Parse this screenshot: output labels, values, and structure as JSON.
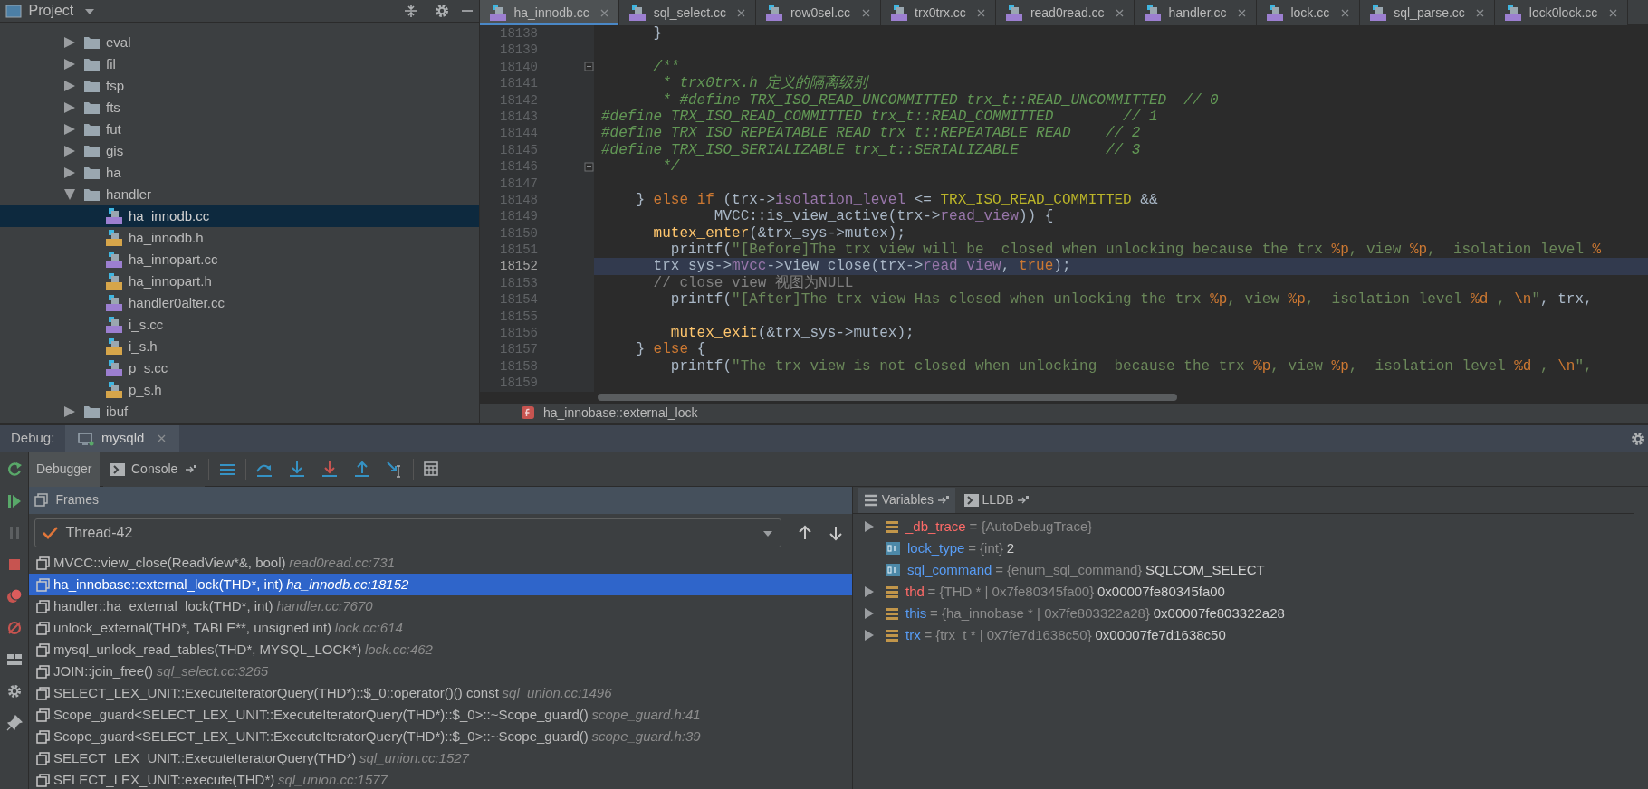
{
  "project_panel": {
    "title": "Project",
    "tree": [
      {
        "label": "eval",
        "kind": "folder",
        "expanded": false,
        "selected": false
      },
      {
        "label": "fil",
        "kind": "folder",
        "expanded": false,
        "selected": false
      },
      {
        "label": "fsp",
        "kind": "folder",
        "expanded": false,
        "selected": false
      },
      {
        "label": "fts",
        "kind": "folder",
        "expanded": false,
        "selected": false
      },
      {
        "label": "fut",
        "kind": "folder",
        "expanded": false,
        "selected": false
      },
      {
        "label": "gis",
        "kind": "folder",
        "expanded": false,
        "selected": false
      },
      {
        "label": "ha",
        "kind": "folder",
        "expanded": false,
        "selected": false
      },
      {
        "label": "handler",
        "kind": "folder",
        "expanded": true,
        "selected": false,
        "children": [
          {
            "label": "ha_innodb.cc",
            "kind": "cpp",
            "selected": true
          },
          {
            "label": "ha_innodb.h",
            "kind": "header",
            "selected": false
          },
          {
            "label": "ha_innopart.cc",
            "kind": "cpp",
            "selected": false
          },
          {
            "label": "ha_innopart.h",
            "kind": "header",
            "selected": false
          },
          {
            "label": "handler0alter.cc",
            "kind": "cpp",
            "selected": false
          },
          {
            "label": "i_s.cc",
            "kind": "cpp",
            "selected": false
          },
          {
            "label": "i_s.h",
            "kind": "header",
            "selected": false
          },
          {
            "label": "p_s.cc",
            "kind": "cpp",
            "selected": false
          },
          {
            "label": "p_s.h",
            "kind": "header",
            "selected": false
          }
        ]
      },
      {
        "label": "ibuf",
        "kind": "folder",
        "expanded": false,
        "selected": false
      }
    ]
  },
  "editor": {
    "tabs": [
      {
        "label": "ha_innodb.cc",
        "selected": true
      },
      {
        "label": "sql_select.cc",
        "selected": false
      },
      {
        "label": "row0sel.cc",
        "selected": false
      },
      {
        "label": "trx0trx.cc",
        "selected": false
      },
      {
        "label": "read0read.cc",
        "selected": false
      },
      {
        "label": "handler.cc",
        "selected": false
      },
      {
        "label": "lock.cc",
        "selected": false
      },
      {
        "label": "sql_parse.cc",
        "selected": false
      },
      {
        "label": "lock0lock.cc",
        "selected": false
      }
    ],
    "lines": [
      {
        "number": "18138",
        "current": false,
        "tokens": [
          {
            "text": "      }",
            "kind": "plain"
          }
        ]
      },
      {
        "number": "18139",
        "current": false
      },
      {
        "number": "18140",
        "current": false,
        "fold": true,
        "tokens": [
          {
            "text": "      /**",
            "kind": "doc"
          }
        ]
      },
      {
        "number": "18141",
        "current": false,
        "tokens": [
          {
            "text": "       * trx0trx.h 定义的隔离级别",
            "kind": "doc"
          }
        ]
      },
      {
        "number": "18142",
        "current": false,
        "tokens": [
          {
            "text": "       * #define TRX_ISO_READ_UNCOMMITTED trx_t::READ_UNCOMMITTED  // 0",
            "kind": "doc"
          }
        ]
      },
      {
        "number": "18143",
        "current": false,
        "tokens": [
          {
            "text": "#define TRX_ISO_READ_COMMITTED trx_t::READ_COMMITTED        // 1",
            "kind": "doc"
          }
        ]
      },
      {
        "number": "18144",
        "current": false,
        "tokens": [
          {
            "text": "#define TRX_ISO_REPEATABLE_READ trx_t::REPEATABLE_READ    // 2",
            "kind": "doc"
          }
        ]
      },
      {
        "number": "18145",
        "current": false,
        "tokens": [
          {
            "text": "#define TRX_ISO_SERIALIZABLE trx_t::SERIALIZABLE          // 3",
            "kind": "doc"
          }
        ]
      },
      {
        "number": "18146",
        "current": false,
        "fold": true,
        "tokens": [
          {
            "text": "       */",
            "kind": "doc"
          }
        ]
      },
      {
        "number": "18147",
        "current": false
      },
      {
        "number": "18148",
        "current": false,
        "tokens": [
          {
            "text": "    }",
            "kind": "plain"
          },
          {
            "text": " else if",
            "kind": "kw"
          },
          {
            "text": " (trx->",
            "kind": "plain"
          },
          {
            "text": "isolation_level",
            "kind": "field"
          },
          {
            "text": " <= ",
            "kind": "plain"
          },
          {
            "text": "TRX_ISO_READ_COMMITTED",
            "kind": "macro"
          },
          {
            "text": " &&",
            "kind": "plain"
          }
        ]
      },
      {
        "number": "18149",
        "current": false,
        "tokens": [
          {
            "text": "             MVCC::is_view_active(trx->",
            "kind": "plain"
          },
          {
            "text": "read_view",
            "kind": "field"
          },
          {
            "text": ")) {",
            "kind": "plain"
          }
        ]
      },
      {
        "number": "18150",
        "current": false,
        "tokens": [
          {
            "text": "      mutex_enter",
            "kind": "fn"
          },
          {
            "text": "(&trx_sys->mutex);",
            "kind": "plain"
          }
        ]
      },
      {
        "number": "18151",
        "current": false,
        "tokens": [
          {
            "text": "        printf(",
            "kind": "plain"
          },
          {
            "text": "\"[Before]The trx view will be  closed when unlocking because the trx ",
            "kind": "str"
          },
          {
            "text": "%p",
            "kind": "fmt"
          },
          {
            "text": ", view ",
            "kind": "str"
          },
          {
            "text": "%p",
            "kind": "fmt"
          },
          {
            "text": ",  isolation level ",
            "kind": "str"
          },
          {
            "text": "%",
            "kind": "fmt"
          }
        ]
      },
      {
        "number": "18152",
        "current": true,
        "tokens": [
          {
            "text": "      trx_sys->",
            "kind": "plain"
          },
          {
            "text": "mvcc",
            "kind": "field"
          },
          {
            "text": "->view_close(trx->",
            "kind": "plain"
          },
          {
            "text": "read_view",
            "kind": "field"
          },
          {
            "text": ", ",
            "kind": "plain"
          },
          {
            "text": "true",
            "kind": "kw"
          },
          {
            "text": ");",
            "kind": "plain"
          }
        ]
      },
      {
        "number": "18153",
        "current": false,
        "tokens": [
          {
            "text": "      // close view 视图为NULL",
            "kind": "comment"
          }
        ]
      },
      {
        "number": "18154",
        "current": false,
        "tokens": [
          {
            "text": "        printf(",
            "kind": "plain"
          },
          {
            "text": "\"[After]The trx view Has closed when unlocking the trx ",
            "kind": "str"
          },
          {
            "text": "%p",
            "kind": "fmt"
          },
          {
            "text": ", view ",
            "kind": "str"
          },
          {
            "text": "%p",
            "kind": "fmt"
          },
          {
            "text": ",  isolation level ",
            "kind": "str"
          },
          {
            "text": "%d",
            "kind": "fmt"
          },
          {
            "text": " , ",
            "kind": "str"
          },
          {
            "text": "\\n",
            "kind": "fmt"
          },
          {
            "text": "\"",
            "kind": "str"
          },
          {
            "text": ", trx,",
            "kind": "plain"
          }
        ]
      },
      {
        "number": "18155",
        "current": false
      },
      {
        "number": "18156",
        "current": false,
        "tokens": [
          {
            "text": "        mutex_exit",
            "kind": "fn"
          },
          {
            "text": "(&trx_sys->mutex);",
            "kind": "plain"
          }
        ]
      },
      {
        "number": "18157",
        "current": false,
        "tokens": [
          {
            "text": "    }",
            "kind": "plain"
          },
          {
            "text": " else",
            "kind": "kw"
          },
          {
            "text": " {",
            "kind": "plain"
          }
        ]
      },
      {
        "number": "18158",
        "current": false,
        "tokens": [
          {
            "text": "        printf(",
            "kind": "plain"
          },
          {
            "text": "\"The trx view is not closed when unlocking  because the trx ",
            "kind": "str"
          },
          {
            "text": "%p",
            "kind": "fmt"
          },
          {
            "text": ", view ",
            "kind": "str"
          },
          {
            "text": "%p",
            "kind": "fmt"
          },
          {
            "text": ",  isolation level ",
            "kind": "str"
          },
          {
            "text": "%d",
            "kind": "fmt"
          },
          {
            "text": " , ",
            "kind": "str"
          },
          {
            "text": "\\n",
            "kind": "fmt"
          },
          {
            "text": "\",",
            "kind": "str"
          }
        ]
      },
      {
        "number": "18159",
        "current": false
      }
    ],
    "breadcrumb": "ha_innobase::external_lock"
  },
  "debug": {
    "label": "Debug:",
    "session_tab": "mysqld",
    "tabs": [
      {
        "label": "Debugger",
        "selected": true
      },
      {
        "label": "Console",
        "selected": false
      }
    ],
    "frames": {
      "title": "Frames",
      "thread": "Thread-42",
      "items": [
        {
          "function": "MVCC::view_close(ReadView*&, bool)",
          "location": "read0read.cc:731",
          "selected": false
        },
        {
          "function": "ha_innobase::external_lock(THD*, int)",
          "location": "ha_innodb.cc:18152",
          "selected": true
        },
        {
          "function": "handler::ha_external_lock(THD*, int)",
          "location": "handler.cc:7670",
          "selected": false
        },
        {
          "function": "unlock_external(THD*, TABLE**, unsigned int)",
          "location": "lock.cc:614",
          "selected": false
        },
        {
          "function": "mysql_unlock_read_tables(THD*, MYSQL_LOCK*)",
          "location": "lock.cc:462",
          "selected": false
        },
        {
          "function": "JOIN::join_free()",
          "location": "sql_select.cc:3265",
          "selected": false
        },
        {
          "function": "SELECT_LEX_UNIT::ExecuteIteratorQuery(THD*)::$_0::operator()() const",
          "location": "sql_union.cc:1496",
          "selected": false
        },
        {
          "function": "Scope_guard<SELECT_LEX_UNIT::ExecuteIteratorQuery(THD*)::$_0>::~Scope_guard()",
          "location": "scope_guard.h:41",
          "selected": false
        },
        {
          "function": "Scope_guard<SELECT_LEX_UNIT::ExecuteIteratorQuery(THD*)::$_0>::~Scope_guard()",
          "location": "scope_guard.h:39",
          "selected": false
        },
        {
          "function": "SELECT_LEX_UNIT::ExecuteIteratorQuery(THD*)",
          "location": "sql_union.cc:1527",
          "selected": false
        },
        {
          "function": "SELECT_LEX_UNIT::execute(THD*)",
          "location": "sql_union.cc:1577",
          "selected": false
        }
      ]
    },
    "variables": {
      "tabs": [
        {
          "label": "Variables",
          "selected": true
        },
        {
          "label": "LLDB",
          "selected": false
        }
      ],
      "items": [
        {
          "name": "_db_trace",
          "type": "= {AutoDebugTrace}",
          "kind": "object",
          "expandable": true,
          "color": "#ff6b68"
        },
        {
          "name": "lock_type",
          "type": "= {int}",
          "value": "2",
          "kind": "primitive",
          "expandable": false,
          "color": "#589df6"
        },
        {
          "name": "sql_command",
          "type": "= {enum_sql_command}",
          "value": "SQLCOM_SELECT",
          "kind": "primitive",
          "expandable": false,
          "color": "#589df6"
        },
        {
          "name": "thd",
          "type": "= {THD * | 0x7fe80345fa00}",
          "value": "0x00007fe80345fa00",
          "kind": "object",
          "expandable": true,
          "color": "#ff6b68"
        },
        {
          "name": "this",
          "type": "= {ha_innobase * | 0x7fe803322a28}",
          "value": "0x00007fe803322a28",
          "kind": "object",
          "expandable": true,
          "color": "#589df6"
        },
        {
          "name": "trx",
          "type": "= {trx_t * | 0x7fe7d1638c50}",
          "value": "0x00007fe7d1638c50",
          "kind": "object",
          "expandable": true,
          "color": "#589df6"
        }
      ]
    }
  }
}
